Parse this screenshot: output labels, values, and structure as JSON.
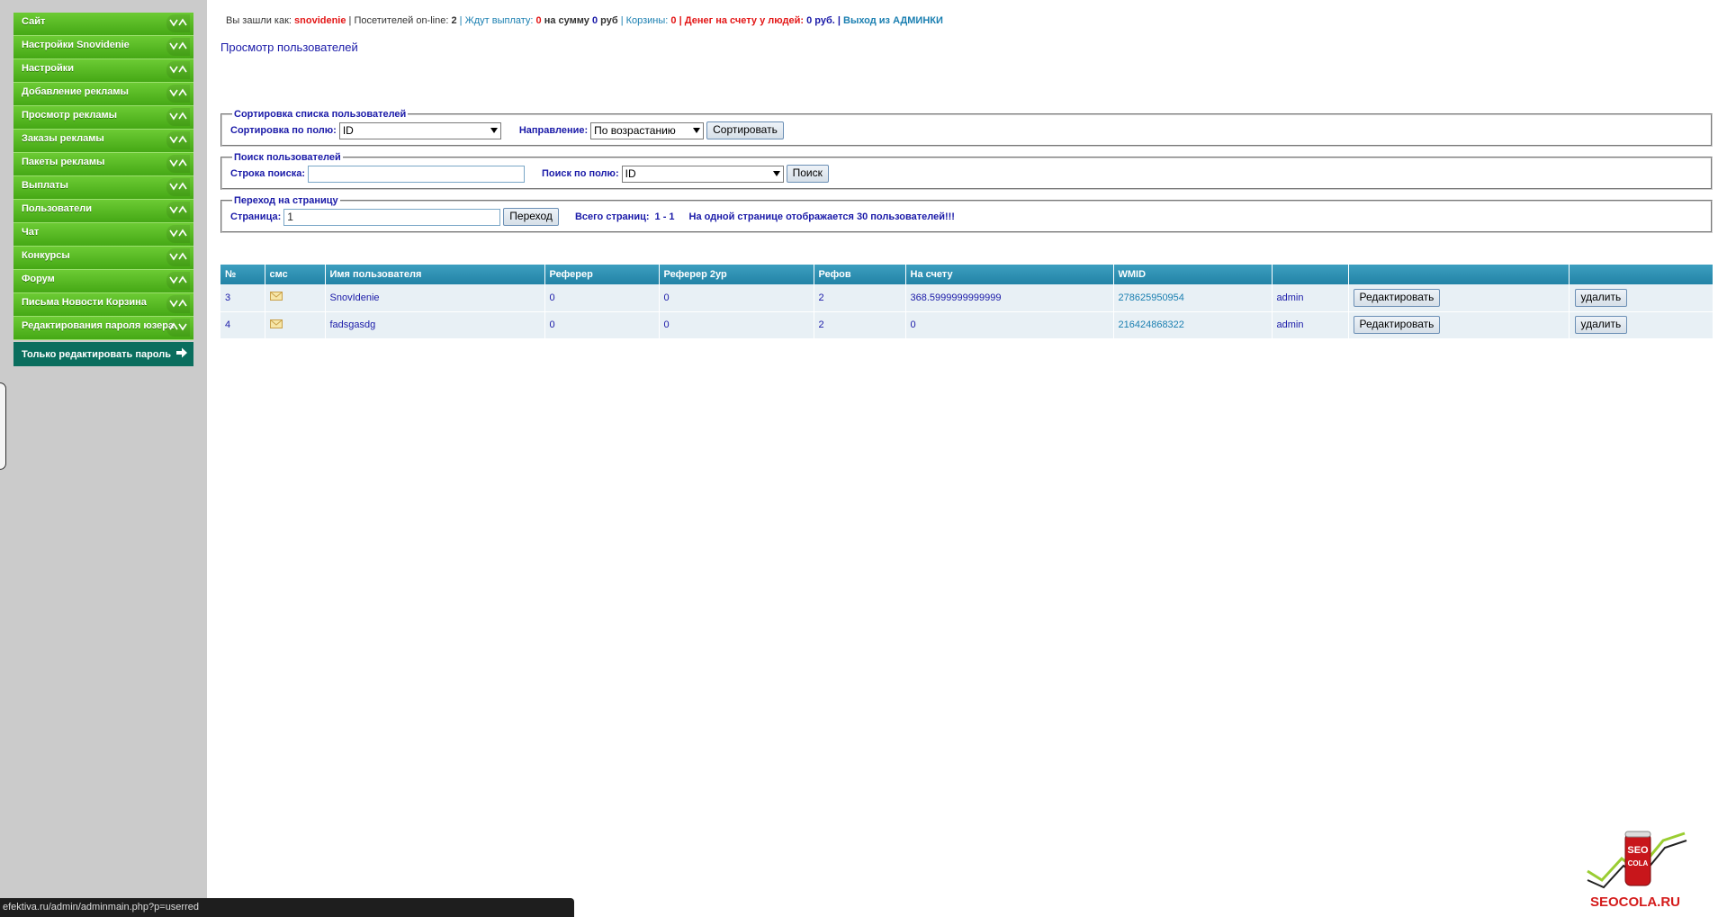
{
  "sidebar": {
    "items": [
      {
        "label": "Сайт"
      },
      {
        "label": "Настройки Snovidenie"
      },
      {
        "label": "Настройки"
      },
      {
        "label": "Добавление рекламы"
      },
      {
        "label": "Просмотр рекламы"
      },
      {
        "label": "Заказы рекламы"
      },
      {
        "label": "Пакеты рекламы"
      },
      {
        "label": "Выплаты"
      },
      {
        "label": "Пользователи"
      },
      {
        "label": "Чат"
      },
      {
        "label": "Конкурсы"
      },
      {
        "label": "Форум"
      },
      {
        "label": "Письма Новости Корзина"
      },
      {
        "label": "Редактирования пароля юзера"
      }
    ],
    "sub_item": "Только редактировать пароль"
  },
  "topbar": {
    "logged_as_label": "Вы зашли как:",
    "username": "snovidenie",
    "online_label": "| Посетителей on-line:",
    "online_count": "2",
    "pending_label": "| Ждут выплату:",
    "pending_count": "0",
    "sum_label": "на сумму",
    "sum_value": "0",
    "sum_unit": "руб",
    "baskets_label": "| Корзины:",
    "baskets_count": "0",
    "money_label": "| Денег на счету у людей:",
    "money_value": "0 руб.",
    "exit_sep": "|",
    "exit_label": "Выход из АДМИНКИ"
  },
  "page_title": "Просмотр пользователей",
  "sort_box": {
    "legend": "Сортировка списка пользователей",
    "field_label": "Сортировка по полю:",
    "field_value": "ID",
    "direction_label": "Направление:",
    "direction_value": "По возрастанию",
    "button": "Сортировать"
  },
  "search_box": {
    "legend": "Поиск пользователей",
    "query_label": "Строка поиска:",
    "query_value": "",
    "field_label": "Поиск по полю:",
    "field_value": "ID",
    "button": "Поиск"
  },
  "page_box": {
    "legend": "Переход на страницу",
    "page_label": "Страница:",
    "page_value": "1",
    "button": "Переход",
    "total_label": "Всего страниц:",
    "total_value": "1 - 1",
    "per_page_note": "На одной странице отображается 30 пользователей!!!"
  },
  "table": {
    "headers": [
      "№",
      "смс",
      "Имя пользователя",
      "Реферер",
      "Реферер 2ур",
      "Рефов",
      "На счету",
      "WMID",
      "",
      "",
      ""
    ],
    "rows": [
      {
        "id": "3",
        "name": "SnovIdenie",
        "referer": "0",
        "referer2": "0",
        "refs": "2",
        "balance": "368.5999999999999",
        "wmid": "278625950954",
        "role": "admin",
        "edit": "Редактировать",
        "delete": "удалить"
      },
      {
        "id": "4",
        "name": "fadsgasdg",
        "referer": "0",
        "referer2": "0",
        "refs": "2",
        "balance": "0",
        "wmid": "216424868322",
        "role": "admin",
        "edit": "Редактировать",
        "delete": "удалить"
      }
    ]
  },
  "status_bar": "efektiva.ru/admin/adminmain.php?p=userred",
  "logo_text": "SEOCOLA.RU",
  "colors": {
    "menu_green": "#4fb11d",
    "submenu_teal": "#0a6e5e",
    "table_header": "#2a8bb0",
    "link_blue": "#1a1aa8"
  }
}
